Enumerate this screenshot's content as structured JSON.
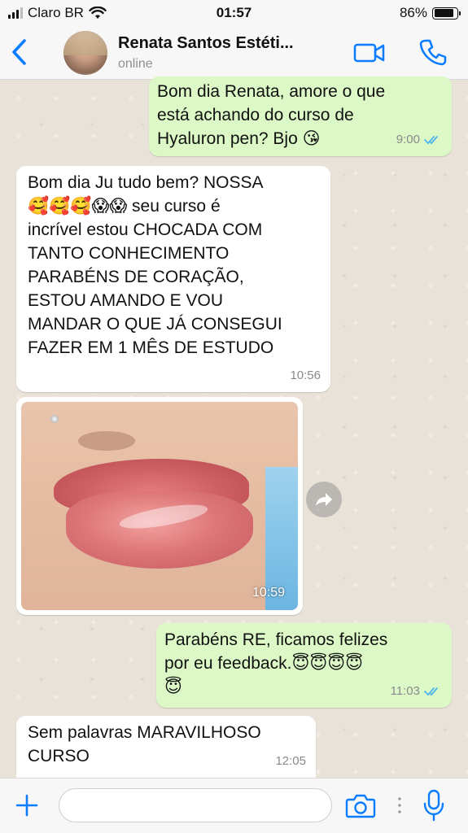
{
  "status_bar": {
    "carrier": "Claro BR",
    "time": "01:57",
    "battery": "86%",
    "battery_level": 0.86
  },
  "header": {
    "contact_name": "Renata Santos Estéti...",
    "status": "online",
    "icons": [
      "back-chevron-icon",
      "video-call-icon",
      "phone-icon"
    ]
  },
  "messages": [
    {
      "direction": "out",
      "text": "Bom dia Renata, amore o que\nestá achando do curso de\nHyaluron pen? Bjo 😘",
      "time": "9:00",
      "read": true
    },
    {
      "direction": "in",
      "text": "Bom dia Ju tudo bem? NOSSA\n🥰🥰🥰😱😱 seu curso é\nincrível estou CHOCADA COM\nTANTO CONHECIMENTO\nPARABÉNS DE CORAÇÃO,\nESTOU AMANDO E VOU\nMANDAR O QUE JÁ CONSEGUI\nFAZER EM 1 MÊS DE ESTUDO",
      "time": "10:56"
    },
    {
      "direction": "in",
      "type": "photo",
      "time": "10:59"
    },
    {
      "direction": "out",
      "text": "Parabéns RE, ficamos felizes\npor eu feedback.😇😇😇😇\n😇",
      "time": "11:03",
      "read": true
    },
    {
      "direction": "in",
      "text": "Sem palavras MARAVILHOSO\nCURSO",
      "time": "12:05"
    }
  ],
  "input_bar": {
    "placeholder": "",
    "icons": [
      "plus-icon",
      "camera-icon",
      "microphone-icon"
    ]
  },
  "colors": {
    "accent": "#0a7cff",
    "outgoing_bubble": "#dcf8c6",
    "incoming_bubble": "#ffffff",
    "read_ticks": "#4fb6ec",
    "chat_background": "#e9e2d8"
  }
}
